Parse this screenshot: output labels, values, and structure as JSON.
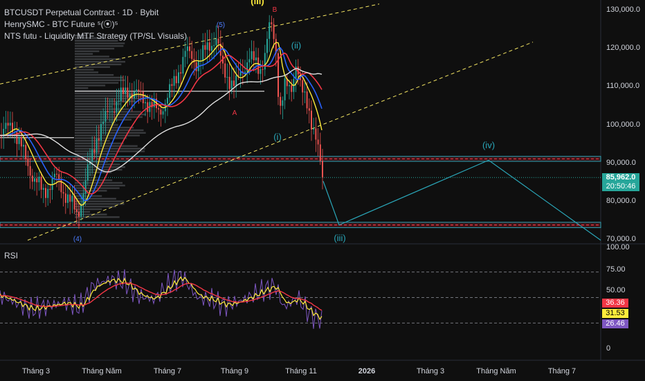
{
  "legend": {
    "line1": "BTCUSDT Perpetual Contract · 1D · Bybit",
    "line2": "HenrySMC - BTC Future ⁵(⦿)⁵",
    "line3": "NTS futu - Liquidity MTF Strategy (TP/SL Visuals)"
  },
  "rsi": {
    "title": "RSI",
    "value_a": "36.36",
    "value_b": "31.53",
    "value_c": "26.46",
    "color_a": "#f23645",
    "color_b": "#ffeb3b",
    "color_c": "#7e57c2",
    "levels": [
      "100.00",
      "75.00",
      "50.00",
      "25.00",
      "0"
    ]
  },
  "price_axis": {
    "ticks": [
      "130,000.0",
      "120,000.0",
      "110,000.0",
      "100,000.0",
      "90,000.0",
      "80,000.0",
      "70,000.0"
    ],
    "current_price": "85,962.0",
    "countdown": "20:50:46",
    "current_color": "#26a69a"
  },
  "time_axis": {
    "labels": [
      "Tháng 3",
      "Tháng Năm",
      "Tháng 7",
      "Tháng 9",
      "Tháng 11",
      "2026",
      "Tháng 3",
      "Tháng Năm",
      "Tháng 7"
    ]
  },
  "wave_labels": {
    "iii_top": "(iii)",
    "b": "B",
    "five": "(5)",
    "ii": "(ii)",
    "a": "A",
    "i": "(i)",
    "iv": "(iv)",
    "iii_bottom": "(iii)",
    "four": "(4)"
  },
  "colors": {
    "background": "#0f0f0f",
    "up_candle": "#26a69a",
    "down_candle": "#ef5350",
    "ema_yellow": "#ffeb3b",
    "ema_blue": "#2962ff",
    "ema_red": "#f23645",
    "ema_white": "#e0e0e0",
    "channel": "#f5e663",
    "projection": "#2aa6b8",
    "zone": "#f23645"
  }
}
